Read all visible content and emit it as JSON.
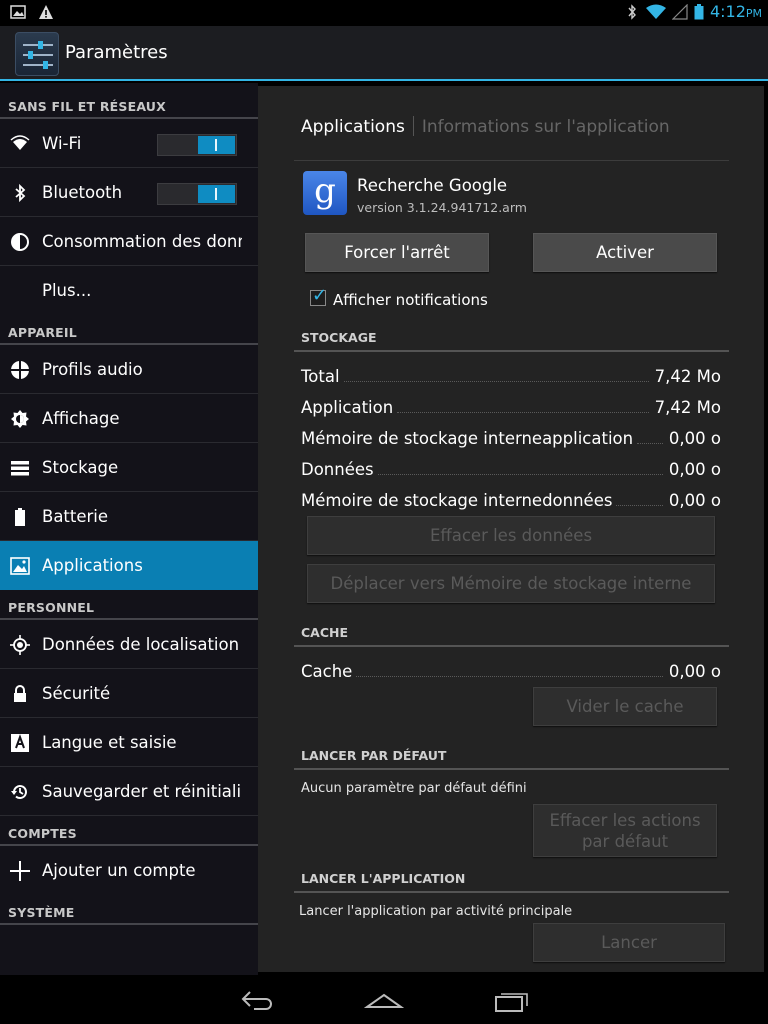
{
  "status_bar": {
    "time": "4:12",
    "ampm": "PM",
    "icons": [
      "image-icon",
      "warning-icon",
      "bluetooth-icon",
      "wifi-icon",
      "signal-icon",
      "battery-icon"
    ]
  },
  "action_bar": {
    "title": "Paramètres",
    "icon": "settings-sliders-icon"
  },
  "sidebar": {
    "sections": {
      "wireless": "SANS FIL ET RÉSEAUX",
      "device": "APPAREIL",
      "personal": "PERSONNEL",
      "accounts": "COMPTES",
      "system": "SYSTÈME"
    },
    "items": {
      "wifi": "Wi-Fi",
      "bluetooth": "Bluetooth",
      "data_usage": "Consommation des données",
      "more": "Plus...",
      "audio_profiles": "Profils audio",
      "display": "Affichage",
      "storage": "Stockage",
      "battery": "Batterie",
      "applications": "Applications",
      "location": "Données de localisation",
      "security": "Sécurité",
      "language": "Langue et saisie",
      "backup": "Sauvegarder et réinitialiser",
      "add_account": "Ajouter un compte"
    },
    "toggles": {
      "wifi_on": true,
      "bluetooth_on": true
    }
  },
  "detail": {
    "breadcrumb": [
      "Applications",
      "Informations sur l'application"
    ],
    "app": {
      "name": "Recherche Google",
      "version": "version 3.1.24.941712.arm",
      "logo_letter": "g"
    },
    "buttons": {
      "force_stop": "Forcer l'arrêt",
      "enable": "Activer",
      "clear_data": "Effacer les données",
      "move": "Déplacer vers Mémoire de stockage interne",
      "clear_cache": "Vider le cache",
      "clear_defaults_1": "Effacer les actions",
      "clear_defaults_2": "par défaut",
      "launch": "Lancer"
    },
    "show_notifications": "Afficher notifications",
    "storage": {
      "header": "STOCKAGE",
      "rows": [
        {
          "label": "Total",
          "value": "7,42 Mo"
        },
        {
          "label": "Application",
          "value": "7,42 Mo"
        },
        {
          "label": "Mémoire de stockage interneapplication",
          "value": "0,00 o"
        },
        {
          "label": "Données",
          "value": "0,00 o"
        },
        {
          "label": "Mémoire de stockage internedonnées",
          "value": "0,00 o"
        }
      ]
    },
    "cache": {
      "header": "CACHE",
      "label": "Cache",
      "value": "0,00 o"
    },
    "launch_default": {
      "header": "LANCER PAR DÉFAUT",
      "text": "Aucun paramètre par défaut défini"
    },
    "launch_app": {
      "header": "LANCER L'APPLICATION",
      "text": "Lancer l'application par activité principale"
    }
  },
  "colors": {
    "accent": "#33b5e5",
    "selected": "#0a7fb3"
  }
}
